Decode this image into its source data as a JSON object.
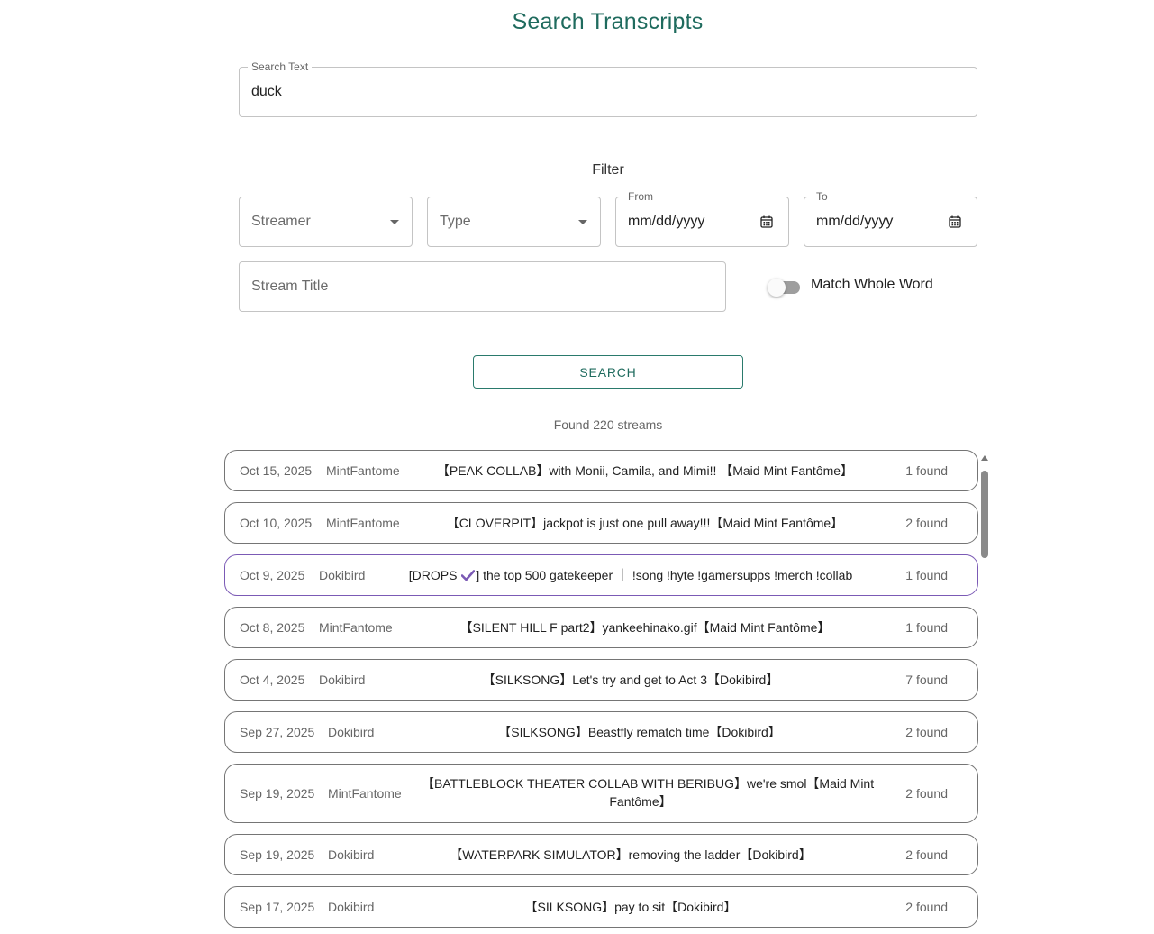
{
  "page": {
    "title": "Search Transcripts"
  },
  "search": {
    "label": "Search Text",
    "value": "duck"
  },
  "filter": {
    "heading": "Filter",
    "streamer_placeholder": "Streamer",
    "type_placeholder": "Type",
    "from_label": "From",
    "from_value": "mm/dd/yyyy",
    "to_label": "To",
    "to_value": "mm/dd/yyyy",
    "stream_title_placeholder": "Stream Title",
    "match_whole_word_label": "Match Whole Word",
    "match_whole_word_on": false
  },
  "actions": {
    "search_label": "SEARCH"
  },
  "results": {
    "summary": "Found 220 streams",
    "rows": [
      {
        "date": "Oct 15, 2025",
        "streamer": "MintFantome",
        "title": "【PEAK COLLAB】with Monii, Camila, and Mimi!! 【Maid Mint Fantôme】",
        "count": "1 found"
      },
      {
        "date": "Oct 10, 2025",
        "streamer": "MintFantome",
        "title": "【CLOVERPIT】jackpot is just one pull away!!!【Maid Mint Fantôme】",
        "count": "2 found"
      },
      {
        "date": "Oct 9, 2025",
        "streamer": "Dokibird",
        "title_pre": "[DROPS ",
        "title_post": "] the top 500 gatekeeper ｜ !song !hyte !gamersupps !merch !collab",
        "count": "1 found"
      },
      {
        "date": "Oct 8, 2025",
        "streamer": "MintFantome",
        "title": "【SILENT HILL F part2】yankeehinako.gif【Maid Mint Fantôme】",
        "count": "1 found"
      },
      {
        "date": "Oct 4, 2025",
        "streamer": "Dokibird",
        "title": "【SILKSONG】Let's try and get to Act 3【Dokibird】",
        "count": "7 found"
      },
      {
        "date": "Sep 27, 2025",
        "streamer": "Dokibird",
        "title": "【SILKSONG】Beastfly rematch time【Dokibird】",
        "count": "2 found"
      },
      {
        "date": "Sep 19, 2025",
        "streamer": "MintFantome",
        "title_line1": "【BATTLEBLOCK THEATER COLLAB WITH BERIBUG】we're smol【Maid Mint",
        "title_line2": "Fantôme】",
        "count": "2 found"
      },
      {
        "date": "Sep 19, 2025",
        "streamer": "Dokibird",
        "title": "【WATERPARK SIMULATOR】removing the ladder【Dokibird】",
        "count": "2 found"
      },
      {
        "date": "Sep 17, 2025",
        "streamer": "Dokibird",
        "title": "【SILKSONG】pay to sit【Dokibird】",
        "count": "2 found"
      }
    ]
  },
  "colors": {
    "accent": "#1f6b5e",
    "selected_border": "#7b5ab5",
    "check_icon": "#7b5ab5"
  }
}
